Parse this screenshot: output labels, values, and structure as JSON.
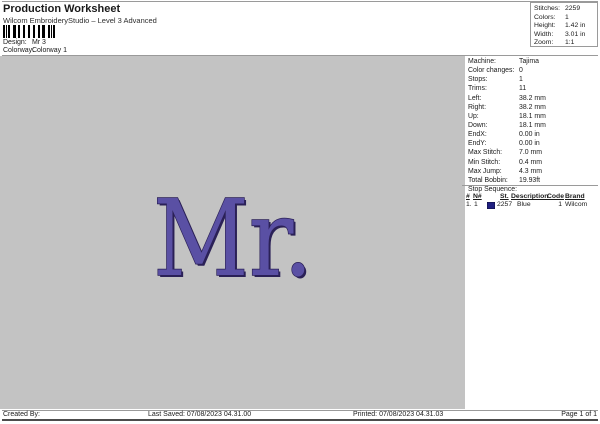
{
  "header": {
    "title": "Production Worksheet",
    "subtitle": "Wilcom EmbroideryStudio – Level 3 Advanced",
    "design_label": "Design:",
    "design_value": "Mr 3",
    "colorway_label": "Colorway:",
    "colorway_value": "Colorway 1"
  },
  "summary": {
    "rows": [
      {
        "label": "Stitches:",
        "value": "2259"
      },
      {
        "label": "Colors:",
        "value": "1"
      },
      {
        "label": "Height:",
        "value": "1.42 in"
      },
      {
        "label": "Width:",
        "value": "3.01 in"
      },
      {
        "label": "Zoom:",
        "value": "1:1"
      }
    ]
  },
  "design_preview": {
    "text": "Mr.",
    "thread_color": "#5a50a4",
    "outline_color": "#2b2157",
    "canvas_color": "#c3c3c3"
  },
  "machine_details": {
    "rows": [
      {
        "label": "Machine:",
        "value": "Tajima"
      },
      {
        "label": "Color changes:",
        "value": "0"
      },
      {
        "label": "Stops:",
        "value": "1"
      },
      {
        "label": "Trims:",
        "value": "11"
      },
      {
        "label": "Left:",
        "value": "38.2 mm"
      },
      {
        "label": "Right:",
        "value": "38.2 mm"
      },
      {
        "label": "Up:",
        "value": "18.1 mm"
      },
      {
        "label": "Down:",
        "value": "18.1 mm"
      },
      {
        "label": "EndX:",
        "value": "0.00 in"
      },
      {
        "label": "EndY:",
        "value": "0.00 in"
      },
      {
        "label": "Max Stitch:",
        "value": "7.0 mm"
      },
      {
        "label": "Min Stitch:",
        "value": "0.4 mm"
      },
      {
        "label": "Max Jump:",
        "value": "4.3 mm"
      },
      {
        "label": "Total Bobbin:",
        "value": "19.93ft"
      }
    ]
  },
  "stop_sequence": {
    "title": "Stop Sequence:",
    "columns": {
      "num": "#",
      "n": "N#",
      "st": "St.",
      "description": "Description",
      "code": "Code",
      "brand": "Brand"
    },
    "rows": [
      {
        "num": "1.",
        "n": "1",
        "swatch_color": "#1f1f80",
        "st": "2257",
        "description": "Blue",
        "code": "1",
        "brand": "Wilcom"
      }
    ]
  },
  "footer": {
    "created_by": "Created By:",
    "last_saved": "Last Saved: 07/08/2023 04.31.00",
    "printed": "Printed: 07/08/2023 04.31.03",
    "page": "Page 1 of 1"
  }
}
